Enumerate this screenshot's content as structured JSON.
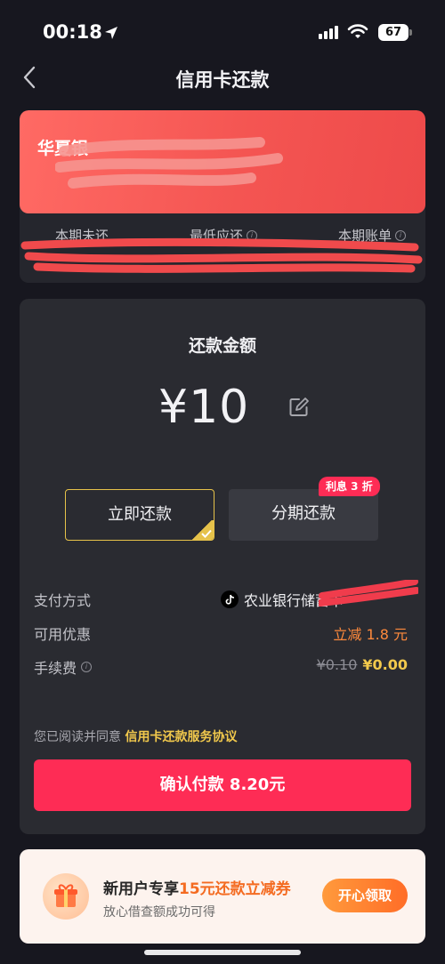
{
  "status_bar": {
    "time": "00:18",
    "battery": "67"
  },
  "nav": {
    "title": "信用卡还款"
  },
  "card": {
    "bank_name_visible": "华夏银",
    "labels": [
      "本期未还",
      "最低应还",
      "本期账单"
    ]
  },
  "payment": {
    "amount_title": "还款金额",
    "amount": "¥10",
    "options": {
      "pay_now": "立即还款",
      "installment": "分期还款",
      "installment_badge": "利息 3 折"
    },
    "rows": {
      "method_label": "支付方式",
      "method_value": "农业银行储蓄卡",
      "promo_label": "可用优惠",
      "promo_value": "立减 1.8 元",
      "fee_label": "手续费",
      "fee_original": "¥0.10",
      "fee_final": "¥0.00"
    },
    "agreement_prefix": "您已阅读并同意",
    "agreement_link": "信用卡还款服务协议",
    "confirm_button": "确认付款 8.20元"
  },
  "promo_banner": {
    "title_prefix": "新用户专享",
    "title_highlight": "15元还款立减券",
    "subtitle": "放心借查额成功可得",
    "button": "开心领取"
  },
  "colors": {
    "background": "#17171f",
    "panel": "#2a2b31",
    "accent_red": "#fe2c55",
    "gold": "#e6c24a",
    "orange": "#ff8a3c"
  },
  "icons": [
    "location-arrow-icon",
    "signal-icon",
    "wifi-icon",
    "battery-icon",
    "back-chevron-icon",
    "info-icon",
    "edit-icon",
    "checkmark-icon",
    "tiktok-icon",
    "gift-icon"
  ]
}
